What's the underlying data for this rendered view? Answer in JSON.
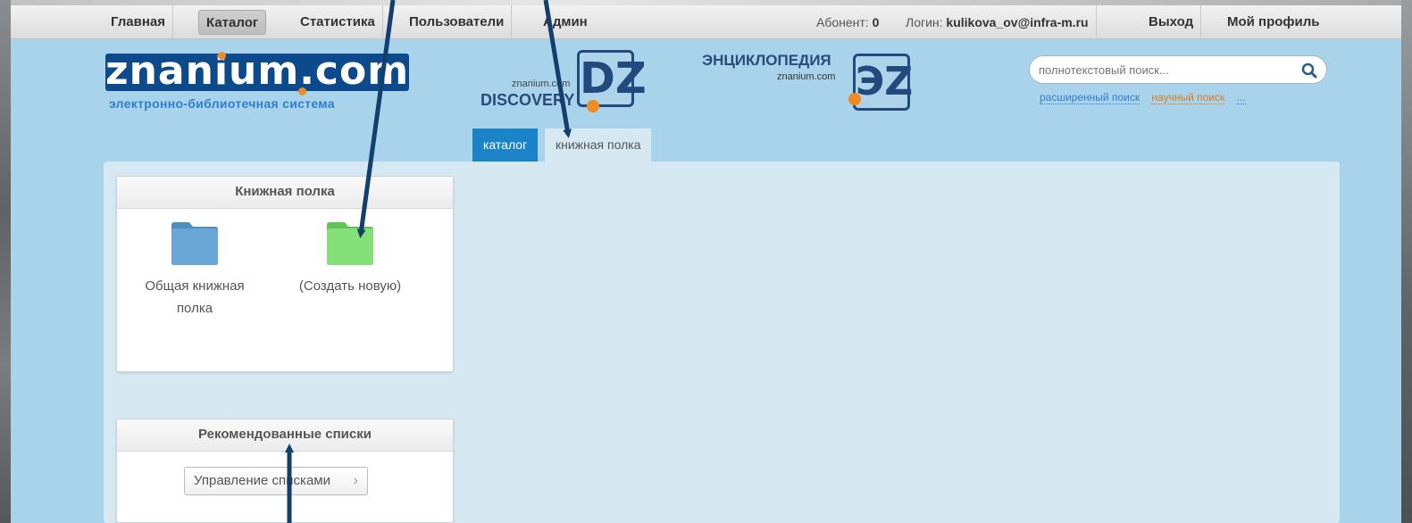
{
  "nav": {
    "items": [
      {
        "label": "Главная"
      },
      {
        "label": "Каталог"
      },
      {
        "label": "Статистика"
      },
      {
        "label": "Пользователи"
      },
      {
        "label": "Админ"
      }
    ],
    "active": "Каталог",
    "abonent_label": "Абонент:",
    "abonent_value": "0",
    "login_label": "Логин:",
    "login_value": "kulikova_ov@infra-m.ru",
    "logout": "Выход",
    "profile": "Мой профиль"
  },
  "brand": {
    "logo": "znanium.com",
    "subtitle": "электронно-библиотечная система",
    "discovery_small": "znanium.com",
    "discovery_big": "DISCOVERY",
    "dz_mark": "DZ",
    "encyclopedia_title": "ЭНЦИКЛОПЕДИЯ",
    "encyclopedia_small": "znanium.com",
    "ez_mark": "ЭZ",
    "brand_color": "#0d4a8c",
    "accent_color": "#f08a22"
  },
  "search": {
    "placeholder": "полнотекстовый поиск...",
    "icon": "search-icon",
    "advanced": "расширенный поиск",
    "scientific": "научный поиск",
    "more": "..."
  },
  "tabs": [
    {
      "label": "каталог",
      "active": true
    },
    {
      "label": "книжная полка",
      "active": false
    }
  ],
  "bookshelf": {
    "title": "Книжная полка",
    "folders": [
      {
        "label": "Общая книжная полка",
        "icon": "folder-blue-icon",
        "color": "#5b9ccc"
      },
      {
        "label": "(Создать новую)",
        "icon": "folder-green-icon",
        "color": "#7fd86e"
      }
    ]
  },
  "recommended": {
    "title": "Рекомендованные списки",
    "manage_button": "Управление списками",
    "chevron": "›"
  },
  "colors": {
    "page_bg": "#a9d3ea",
    "panel_bg": "#d6e9f3",
    "tab_active": "#1b84c8",
    "arrow": "#123f6e"
  }
}
